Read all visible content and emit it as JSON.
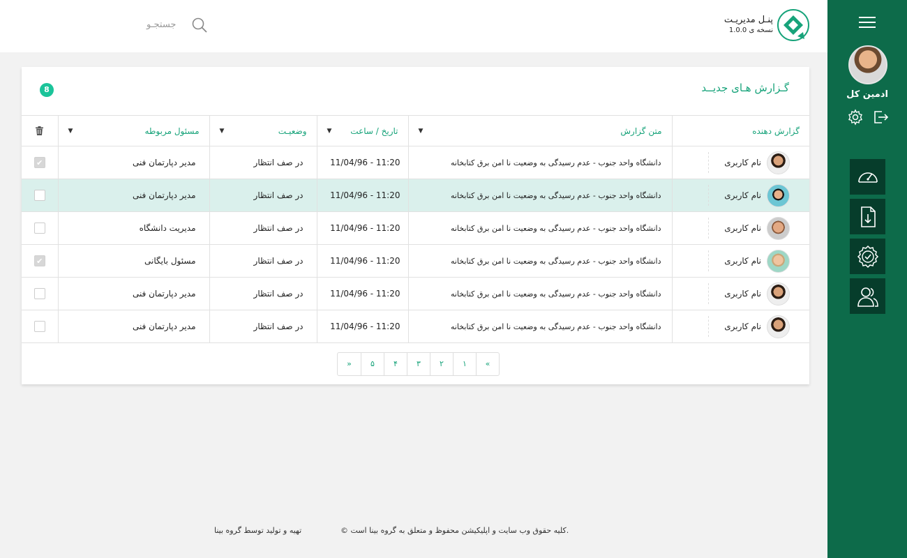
{
  "header": {
    "logo_title": "پنـل مدیریـت",
    "logo_version": "نسخه ی 1.0.0",
    "search_placeholder": "جستجـو"
  },
  "sidebar": {
    "admin_name": "ادمین کل",
    "nav_icons": [
      "dashboard-gauge-icon",
      "download-file-icon",
      "badge-check-icon",
      "users-icon"
    ]
  },
  "card": {
    "title": "گـزارش هـای جدیــد",
    "badge_count": "8",
    "columns": {
      "reporter": "گزارش دهنده",
      "text": "متن گزارش",
      "datetime": "تاریخ / ساعت",
      "status": "وضعیـت",
      "owner": "مسئول مربوطه"
    },
    "rows": [
      {
        "user": "نام کاربری",
        "text": "دانشگاه واحد جنوب - عدم رسیدگی به وضعیت نا امن برق کتابخانه",
        "datetime": "11/04/96  -  11:20",
        "status": "در صف انتظار",
        "owner": "مدیر دپارتمان فنی",
        "checked": true,
        "selected": false
      },
      {
        "user": "نام کاربری",
        "text": "دانشگاه واحد جنوب - عدم رسیدگی به وضعیت نا امن برق کتابخانه",
        "datetime": "11/04/96  -  11:20",
        "status": "در صف انتظار",
        "owner": "مدیر دپارتمان فنی",
        "checked": false,
        "selected": true
      },
      {
        "user": "نام کاربری",
        "text": "دانشگاه واحد جنوب - عدم رسیدگی به وضعیت نا امن برق کتابخانه",
        "datetime": "11/04/96  -  11:20",
        "status": "در صف انتظار",
        "owner": "مدیریت دانشگاه",
        "checked": false,
        "selected": false
      },
      {
        "user": "نام کاربری",
        "text": "دانشگاه واحد جنوب - عدم رسیدگی به وضعیت نا امن برق کتابخانه",
        "datetime": "11/04/96  -  11:20",
        "status": "در صف انتظار",
        "owner": "مسئول بایگانی",
        "checked": true,
        "selected": false
      },
      {
        "user": "نام کاربری",
        "text": "دانشگاه واحد جنوب - عدم رسیدگی به وضعیت نا امن برق کتابخانه",
        "datetime": "11/04/96  -  11:20",
        "status": "در صف انتظار",
        "owner": "مدیر دپارتمان فنی",
        "checked": false,
        "selected": false
      },
      {
        "user": "نام کاربری",
        "text": "دانشگاه واحد جنوب - عدم رسیدگی به وضعیت نا امن برق کتابخانه",
        "datetime": "11/04/96  -  11:20",
        "status": "در صف انتظار",
        "owner": "مدیر دپارتمان فنی",
        "checked": false,
        "selected": false
      }
    ],
    "pagination": [
      "»",
      "۵",
      "۴",
      "۳",
      "۲",
      "۱",
      "«"
    ]
  },
  "footer": {
    "copyright": "© کلیه حقوق وب سایت و اپلیکیشن محفوظ و متعلق به گروه بینا است.",
    "made_by": "تهیه و تولید توسط گروه بینا"
  },
  "colors": {
    "sidebar": "#0d6b4a",
    "sidebar_nav": "#063d2b",
    "accent": "#17a37a",
    "selected_row": "#daf0ec"
  }
}
